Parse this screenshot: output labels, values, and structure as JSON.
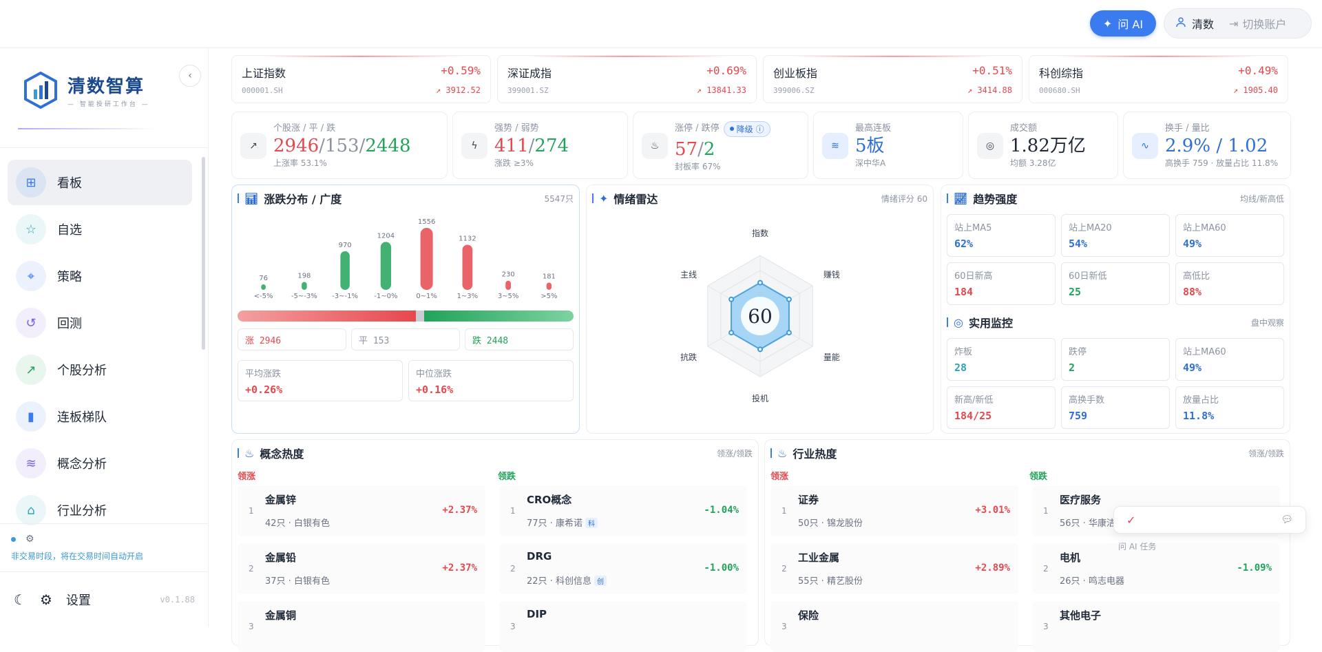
{
  "topbar": {
    "ask_ai": "问 AI",
    "user": "清数",
    "switch": "切换账户"
  },
  "sidebar": {
    "logo_title": "清数智算",
    "logo_sub": "— 智能投研工作台 —",
    "items": [
      {
        "label": "看板",
        "icon": "grid-icon",
        "color": "#3b7bf0"
      },
      {
        "label": "自选",
        "icon": "star-icon",
        "color": "#2fa3b8"
      },
      {
        "label": "策略",
        "icon": "target-icon",
        "color": "#3b7bf0"
      },
      {
        "label": "回测",
        "icon": "history-icon",
        "color": "#7c5ce6"
      },
      {
        "label": "个股分析",
        "icon": "trend-icon",
        "color": "#22a35a"
      },
      {
        "label": "连板梯队",
        "icon": "bars-icon",
        "color": "#3b7bf0"
      },
      {
        "label": "概念分析",
        "icon": "layers-icon",
        "color": "#7c5ce6"
      },
      {
        "label": "行业分析",
        "icon": "bank-icon",
        "color": "#2fa3b8"
      }
    ],
    "status": "非交易时段，将在交易时间自动开启",
    "settings": "设置",
    "version": "v0.1.88"
  },
  "indices": [
    {
      "name": "上证指数",
      "code": "000001.SH",
      "pct": "+0.59%",
      "value": "3912.52"
    },
    {
      "name": "深证成指",
      "code": "399001.SZ",
      "pct": "+0.69%",
      "value": "13841.33"
    },
    {
      "name": "创业板指",
      "code": "399006.SZ",
      "pct": "+0.51%",
      "value": "3414.88"
    },
    {
      "name": "科创综指",
      "code": "000680.SH",
      "pct": "+0.49%",
      "value": "1905.40"
    }
  ],
  "stats": {
    "breadth": {
      "label": "个股涨 / 平 / 跌",
      "up": "2946",
      "flat": "153",
      "down": "2448",
      "sub": "上涨率 53.1%"
    },
    "strength": {
      "label": "强势 / 弱势",
      "strong": "411",
      "weak": "274",
      "sub": "涨跌 ≥3%"
    },
    "limit": {
      "label": "涨停 / 跌停",
      "up": "57",
      "down": "2",
      "badge": "降级",
      "sub": "封板率 67%"
    },
    "streak": {
      "label": "最高连板",
      "value": "5板",
      "sub": "深中华A"
    },
    "turnover": {
      "label": "成交额",
      "value": "1.82万亿",
      "sub": "均额 3.28亿"
    },
    "ratio": {
      "label": "换手 / 量比",
      "value": "2.9% / 1.02",
      "sub": "高换手 759 · 放量占比 11.8%"
    }
  },
  "distribution": {
    "title": "涨跌分布 / 广度",
    "count": "5547只",
    "summary": {
      "up": "涨 2946",
      "flat": "平 153",
      "down": "跌 2448"
    },
    "up_share": 0.531,
    "avg_label": "平均涨跌",
    "avg": "+0.26%",
    "median_label": "中位涨跌",
    "median": "+0.16%"
  },
  "chart_data": {
    "type": "bar",
    "categories": [
      "<-5%",
      "-5~-3%",
      "-3~-1%",
      "-1~0%",
      "0~1%",
      "1~3%",
      "3~5%",
      ">5%"
    ],
    "values": [
      76,
      198,
      970,
      1204,
      1556,
      1132,
      230,
      181
    ],
    "colors": [
      "#22a35a",
      "#22a35a",
      "#22a35a",
      "#22a35a",
      "#e5484d",
      "#e5484d",
      "#e5484d",
      "#e5484d"
    ]
  },
  "radar": {
    "title": "情绪雷达",
    "score_label": "情绪评分 60",
    "score": "60",
    "axes": [
      "指数",
      "赚钱",
      "量能",
      "投机",
      "抗跌",
      "主线"
    ],
    "values": [
      0.55,
      0.55,
      0.55,
      0.55,
      0.55,
      0.55
    ]
  },
  "trend": {
    "title": "趋势强度",
    "right": "均线/新高低",
    "cells": [
      {
        "label": "站上MA5",
        "value": "62%",
        "color": "#2f6fd6"
      },
      {
        "label": "站上MA20",
        "value": "54%",
        "color": "#2f6fd6"
      },
      {
        "label": "站上MA60",
        "value": "49%",
        "color": "#2f6fd6"
      },
      {
        "label": "60日新高",
        "value": "184",
        "color": "#e5484d"
      },
      {
        "label": "60日新低",
        "value": "25",
        "color": "#22a35a"
      },
      {
        "label": "高低比",
        "value": "88%",
        "color": "#e5484d"
      }
    ]
  },
  "monitor": {
    "title": "实用监控",
    "right": "盘中观察",
    "cells": [
      {
        "label": "炸板",
        "value": "28",
        "color": "#2fa3b8"
      },
      {
        "label": "跌停",
        "value": "2",
        "color": "#22a35a"
      },
      {
        "label": "站上MA60",
        "value": "49%",
        "color": "#2f6fd6"
      },
      {
        "label": "新高/新低",
        "value": "184/25",
        "color": "#e5484d"
      },
      {
        "label": "高换手数",
        "value": "759",
        "color": "#2f6fd6"
      },
      {
        "label": "放量占比",
        "value": "11.8%",
        "color": "#2f6fd6"
      }
    ]
  },
  "concept": {
    "title": "概念热度",
    "right": "领涨/领跌",
    "lead_up": "领涨",
    "lead_down": "领跌",
    "up": [
      {
        "rank": "1",
        "name": "金属锌",
        "count": "42只",
        "stock": "白银有色",
        "pct": "+2.37%"
      },
      {
        "rank": "2",
        "name": "金属铅",
        "count": "37只",
        "stock": "白银有色",
        "pct": "+2.37%"
      },
      {
        "rank": "3",
        "name": "金属铜",
        "count": "",
        "stock": "",
        "pct": ""
      }
    ],
    "down": [
      {
        "rank": "1",
        "name": "CRO概念",
        "count": "77只",
        "stock": "康希诺",
        "tag": "科",
        "pct": "-1.04%"
      },
      {
        "rank": "2",
        "name": "DRG",
        "count": "22只",
        "stock": "科创信息",
        "tag": "创",
        "pct": "-1.00%"
      },
      {
        "rank": "3",
        "name": "DIP",
        "count": "",
        "stock": "",
        "tag": "",
        "pct": ""
      }
    ]
  },
  "industry": {
    "title": "行业热度",
    "right": "领涨/领跌",
    "lead_up": "领涨",
    "lead_down": "领跌",
    "up": [
      {
        "rank": "1",
        "name": "证券",
        "count": "50只",
        "stock": "锦龙股份",
        "pct": "+3.01%"
      },
      {
        "rank": "2",
        "name": "工业金属",
        "count": "55只",
        "stock": "精艺股份",
        "pct": "+2.89%"
      },
      {
        "rank": "3",
        "name": "保险",
        "count": "",
        "stock": "",
        "pct": ""
      }
    ],
    "down": [
      {
        "rank": "1",
        "name": "医疗服务",
        "count": "56只",
        "stock": "华康洁",
        "pct": ""
      },
      {
        "rank": "2",
        "name": "电机",
        "count": "26只",
        "stock": "鸣志电器",
        "pct": "-1.09%"
      },
      {
        "rank": "3",
        "name": "其他电子",
        "count": "",
        "stock": "",
        "pct": ""
      }
    ]
  },
  "floating": {
    "sub": "问 AI 任务"
  }
}
